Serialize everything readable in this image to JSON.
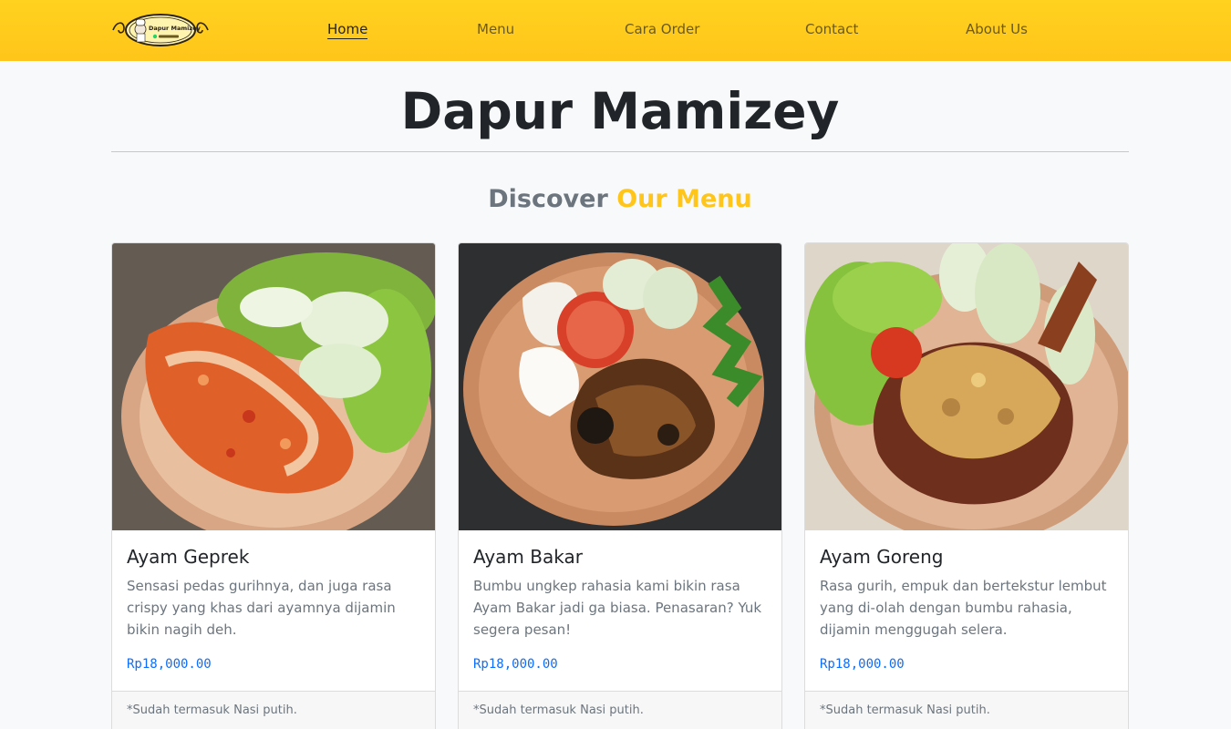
{
  "nav": {
    "logo_text": "Dapur Mamizey",
    "links": [
      {
        "label": "Home",
        "active": true
      },
      {
        "label": "Menu"
      },
      {
        "label": "Cara Order"
      },
      {
        "label": "Contact"
      },
      {
        "label": "About Us"
      }
    ]
  },
  "header": {
    "title": "Dapur Mamizey",
    "section_heading_part1": "Discover",
    "section_heading_part2": "Our Menu"
  },
  "colors": {
    "navbar": "#ffc51a",
    "accent": "#ffc51a",
    "price": "#0d6efd",
    "muted_text": "#6c757d"
  },
  "menu": [
    {
      "title": "Ayam Geprek",
      "image": "ayam-geprek-photo",
      "description": "Sensasi pedas gurihnya, dan juga rasa crispy yang khas dari ayamnya dijamin bikin nagih deh.",
      "price": "Rp18,000.00",
      "footer": "*Sudah termasuk Nasi putih."
    },
    {
      "title": "Ayam Bakar",
      "image": "ayam-bakar-photo",
      "description": "Bumbu ungkep rahasia kami bikin rasa Ayam Bakar jadi ga biasa. Penasaran? Yuk segera pesan!",
      "price": "Rp18,000.00",
      "footer": "*Sudah termasuk Nasi putih."
    },
    {
      "title": "Ayam Goreng",
      "image": "ayam-goreng-photo",
      "description": "Rasa gurih, empuk dan bertekstur lembut yang di-olah dengan bumbu rahasia, dijamin menggugah selera.",
      "price": "Rp18,000.00",
      "footer": "*Sudah termasuk Nasi putih."
    }
  ]
}
